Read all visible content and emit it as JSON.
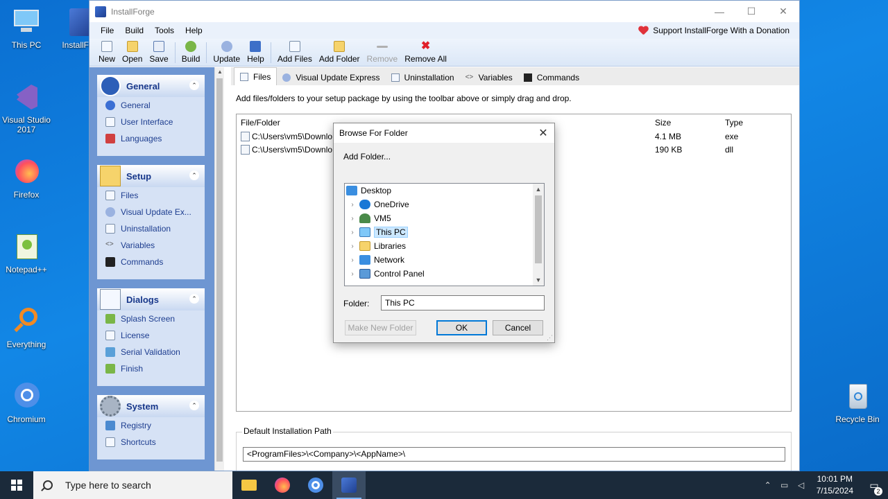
{
  "desktop": {
    "icons": [
      {
        "label": "This PC",
        "icon": "this-pc-icon"
      },
      {
        "label": "InstallFor",
        "icon": "installforge-icon"
      },
      {
        "label": "Visual Studio 2017",
        "icon": "visual-studio-icon"
      },
      {
        "label": "Firefox",
        "icon": "firefox-icon"
      },
      {
        "label": "Notepad++",
        "icon": "notepadpp-icon"
      },
      {
        "label": "Everything",
        "icon": "everything-icon"
      },
      {
        "label": "Chromium",
        "icon": "chromium-icon"
      },
      {
        "label": "Recycle Bin",
        "icon": "recycle-bin-icon"
      }
    ]
  },
  "window": {
    "title": "InstallForge",
    "controls": {
      "minimize": "—",
      "maximize": "☐",
      "close": "✕"
    }
  },
  "menu": {
    "items": [
      "File",
      "Build",
      "Tools",
      "Help"
    ],
    "donate": "Support InstallForge With a Donation"
  },
  "toolbar": {
    "new": "New",
    "open": "Open",
    "save": "Save",
    "build": "Build",
    "update": "Update",
    "help": "Help",
    "add_files": "Add Files",
    "add_folder": "Add Folder",
    "remove": "Remove",
    "remove_all": "Remove All"
  },
  "sidebar": {
    "general": {
      "title": "General",
      "items": [
        "General",
        "User Interface",
        "Languages"
      ]
    },
    "setup": {
      "title": "Setup",
      "items": [
        "Files",
        "Visual Update Ex...",
        "Uninstallation",
        "Variables",
        "Commands"
      ]
    },
    "dialogs": {
      "title": "Dialogs",
      "items": [
        "Splash Screen",
        "License",
        "Serial Validation",
        "Finish"
      ]
    },
    "system": {
      "title": "System",
      "items": [
        "Registry",
        "Shortcuts"
      ]
    }
  },
  "tabs": [
    "Files",
    "Visual Update Express",
    "Uninstallation",
    "Variables",
    "Commands"
  ],
  "files": {
    "hint": "Add files/folders to your setup package by using the toolbar above or simply drag and drop.",
    "columns": {
      "file": "File/Folder",
      "size": "Size",
      "type": "Type"
    },
    "rows": [
      {
        "path": "C:\\Users\\vm5\\Downlo",
        "size": "4.1 MB",
        "type": "exe"
      },
      {
        "path": "C:\\Users\\vm5\\Downlo",
        "size": "190 KB",
        "type": "dll"
      }
    ]
  },
  "install_path": {
    "label": "Default Installation Path",
    "value": "<ProgramFiles>\\<Company>\\<AppName>\\"
  },
  "dialog": {
    "title": "Browse For Folder",
    "subtitle": "Add Folder...",
    "tree": [
      {
        "label": "Desktop",
        "expandable": false
      },
      {
        "label": "OneDrive",
        "expandable": true
      },
      {
        "label": "VM5",
        "expandable": true
      },
      {
        "label": "This PC",
        "expandable": true,
        "selected": true
      },
      {
        "label": "Libraries",
        "expandable": true
      },
      {
        "label": "Network",
        "expandable": true
      },
      {
        "label": "Control Panel",
        "expandable": true
      }
    ],
    "folder_label": "Folder:",
    "folder_value": "This PC",
    "make_new_folder": "Make New Folder",
    "ok": "OK",
    "cancel": "Cancel"
  },
  "taskbar": {
    "search_placeholder": "Type here to search",
    "time": "10:01 PM",
    "date": "7/15/2024",
    "notification_count": "2"
  }
}
